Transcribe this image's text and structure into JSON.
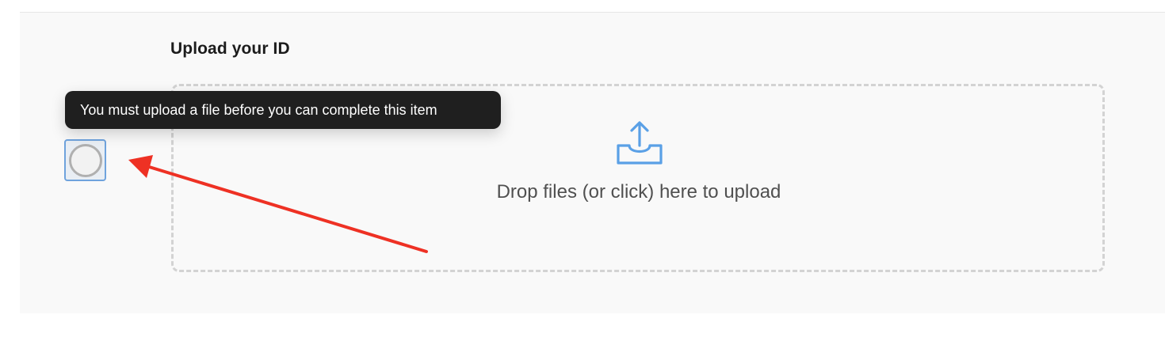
{
  "section": {
    "title": "Upload your ID"
  },
  "upload": {
    "prompt": "Drop files (or click) here to upload",
    "icon": "upload-tray-icon",
    "accent_color": "#5aa0e6"
  },
  "checkbox": {
    "state": "incomplete",
    "icon": "empty-circle-icon"
  },
  "tooltip": {
    "text": "You must upload a file before you can complete this item"
  },
  "annotation": {
    "icon": "red-arrow-icon",
    "color": "#ee3124"
  }
}
